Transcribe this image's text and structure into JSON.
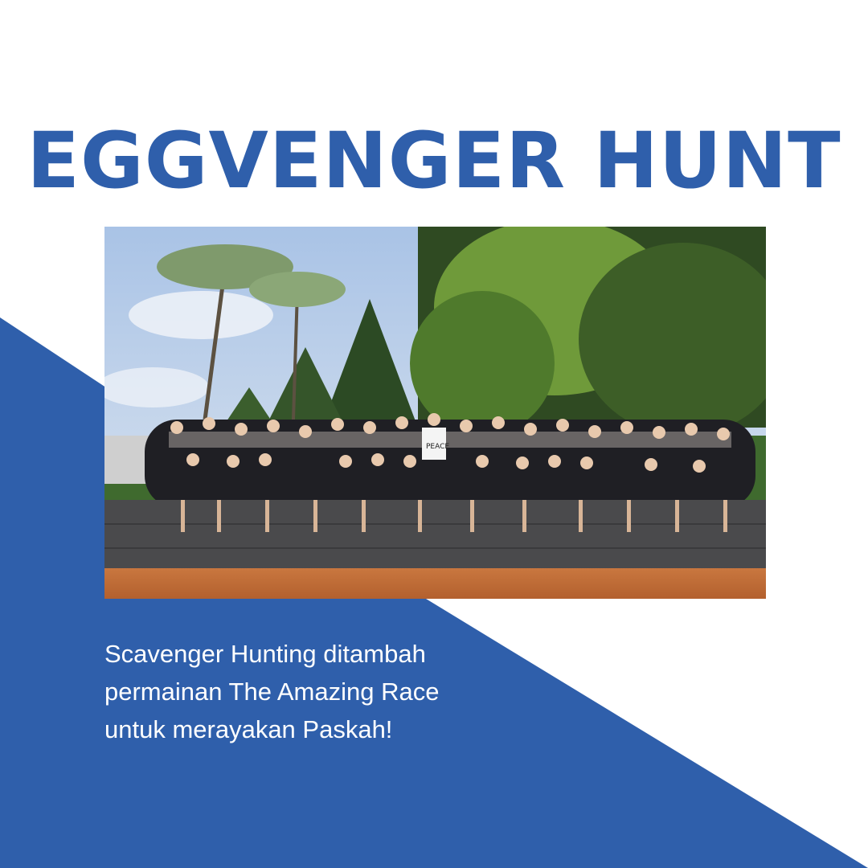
{
  "post": {
    "title": "EGGVENGER HUNT",
    "caption_lines": [
      "Scavenger Hunting ditambah",
      "permainan The Amazing Race",
      "untuk merayakan Paskah!"
    ],
    "photo": {
      "shirt_text": "PEACE"
    }
  },
  "colors": {
    "brand_blue": "#2f5fab",
    "background": "#ffffff",
    "caption_text": "#ffffff"
  }
}
